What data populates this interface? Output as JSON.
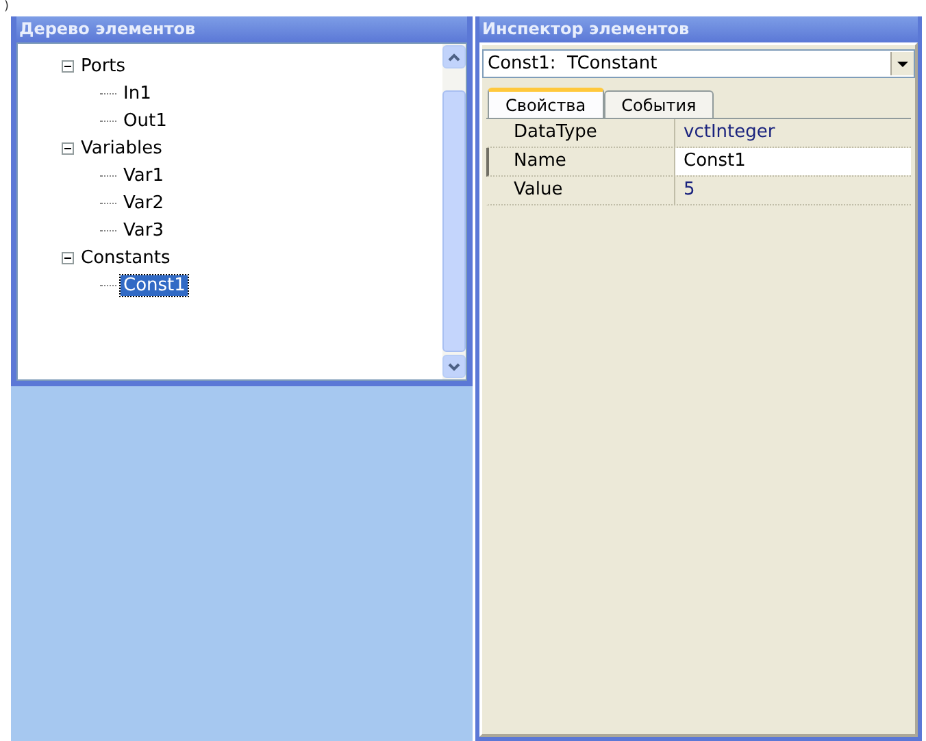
{
  "corner_mark": ")",
  "tree_panel": {
    "title": "Дерево элементов",
    "items": [
      {
        "label": "Ports",
        "expanded": true,
        "selected": false,
        "children": [
          {
            "label": "In1",
            "selected": false
          },
          {
            "label": "Out1",
            "selected": false
          }
        ]
      },
      {
        "label": "Variables",
        "expanded": true,
        "selected": false,
        "children": [
          {
            "label": "Var1",
            "selected": false
          },
          {
            "label": "Var2",
            "selected": false
          },
          {
            "label": "Var3",
            "selected": false
          }
        ]
      },
      {
        "label": "Constants",
        "expanded": true,
        "selected": false,
        "children": [
          {
            "label": "Const1",
            "selected": true
          }
        ]
      }
    ]
  },
  "inspector": {
    "title": "Инспектор элементов",
    "object_select": {
      "value": "Const1:  TConstant"
    },
    "tabs": [
      {
        "label": "Свойства",
        "selected": true
      },
      {
        "label": "События",
        "selected": false
      }
    ],
    "properties": [
      {
        "name": "DataType",
        "value": "vctInteger",
        "selected": false
      },
      {
        "name": "Name",
        "value": "Const1",
        "selected": true
      },
      {
        "name": "Value",
        "value": "5",
        "selected": false
      }
    ]
  }
}
